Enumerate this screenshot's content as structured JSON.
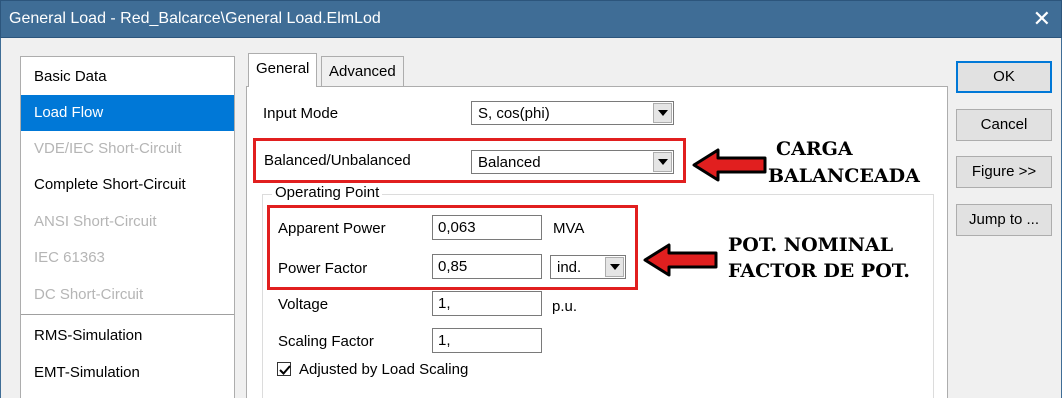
{
  "window": {
    "title": "General Load - Red_Balcarce\\General Load.ElmLod",
    "close_glyph": "✕"
  },
  "sidebar": {
    "items": [
      {
        "label": "Basic Data",
        "state": "normal"
      },
      {
        "label": "Load Flow",
        "state": "selected"
      },
      {
        "label": "VDE/IEC Short-Circuit",
        "state": "disabled"
      },
      {
        "label": "Complete Short-Circuit",
        "state": "normal"
      },
      {
        "label": "ANSI Short-Circuit",
        "state": "disabled"
      },
      {
        "label": "IEC 61363",
        "state": "disabled"
      },
      {
        "label": "DC Short-Circuit",
        "state": "disabled"
      },
      {
        "label": "RMS-Simulation",
        "state": "normal"
      },
      {
        "label": "EMT-Simulation",
        "state": "normal"
      }
    ]
  },
  "tabs": [
    {
      "label": "General",
      "active": true
    },
    {
      "label": "Advanced",
      "active": false
    }
  ],
  "form": {
    "input_mode": {
      "label": "Input Mode",
      "value": "S, cos(phi)"
    },
    "balanced": {
      "label": "Balanced/Unbalanced",
      "value": "Balanced"
    },
    "operating_point": {
      "title": "Operating Point",
      "apparent_power": {
        "label": "Apparent Power",
        "value": "0,063",
        "unit": "MVA"
      },
      "power_factor": {
        "label": "Power Factor",
        "value": "0,85",
        "option": "ind."
      },
      "voltage": {
        "label": "Voltage",
        "value": "1,",
        "unit": "p.u."
      },
      "scaling_factor": {
        "label": "Scaling Factor",
        "value": "1,"
      },
      "adjusted": {
        "label": "Adjusted by Load Scaling",
        "checked": true
      }
    }
  },
  "buttons": {
    "ok": "OK",
    "cancel": "Cancel",
    "figure": "Figure >>",
    "jump": "Jump to ..."
  },
  "annotations": {
    "carga_line1": "CARGA",
    "carga_line2": "BALANCEADA",
    "pot_line1": "POT. NOMINAL",
    "pot_line2": "FACTOR DE POT.",
    "highlight_color": "#e11f1f"
  }
}
